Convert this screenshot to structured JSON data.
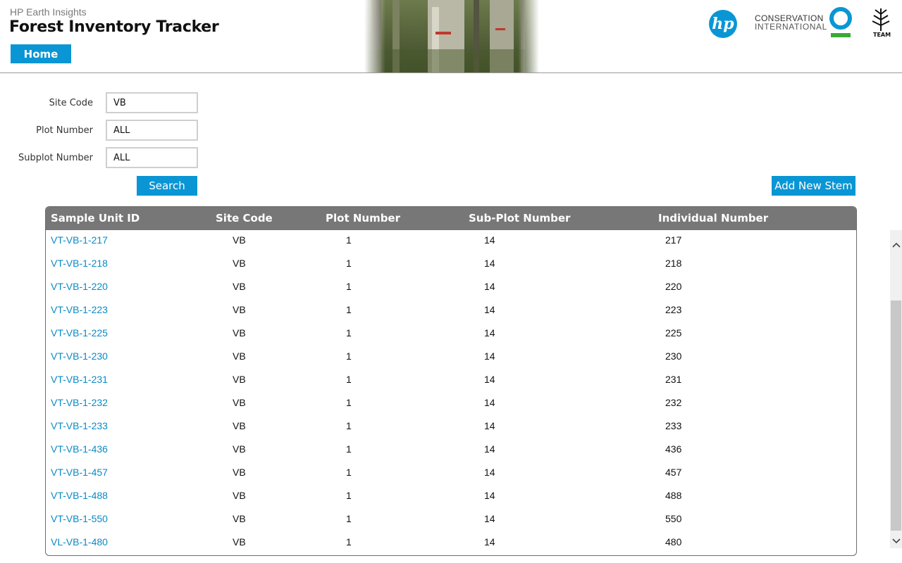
{
  "header": {
    "suite_name": "HP Earth Insights",
    "app_title": "Forest Inventory Tracker",
    "home_label": "Home",
    "hp_logo_text": "hp",
    "ci_line1": "CONSERVATION",
    "ci_line2": "INTERNATIONAL",
    "team_text": "TEAM"
  },
  "filters": {
    "site_code_label": "Site Code",
    "site_code_value": "VB",
    "plot_number_label": "Plot Number",
    "plot_number_value": "ALL",
    "subplot_number_label": "Subplot Number",
    "subplot_number_value": "ALL",
    "search_label": "Search",
    "add_label": "Add New Stem"
  },
  "table": {
    "columns": [
      "Sample Unit ID",
      "Site Code",
      "Plot Number",
      "Sub-Plot Number",
      "Individual Number"
    ],
    "rows": [
      [
        "VT-VB-1-217",
        "VB",
        "1",
        "14",
        "217"
      ],
      [
        "VT-VB-1-218",
        "VB",
        "1",
        "14",
        "218"
      ],
      [
        "VT-VB-1-220",
        "VB",
        "1",
        "14",
        "220"
      ],
      [
        "VT-VB-1-223",
        "VB",
        "1",
        "14",
        "223"
      ],
      [
        "VT-VB-1-225",
        "VB",
        "1",
        "14",
        "225"
      ],
      [
        "VT-VB-1-230",
        "VB",
        "1",
        "14",
        "230"
      ],
      [
        "VT-VB-1-231",
        "VB",
        "1",
        "14",
        "231"
      ],
      [
        "VT-VB-1-232",
        "VB",
        "1",
        "14",
        "232"
      ],
      [
        "VT-VB-1-233",
        "VB",
        "1",
        "14",
        "233"
      ],
      [
        "VT-VB-1-436",
        "VB",
        "1",
        "14",
        "436"
      ],
      [
        "VT-VB-1-457",
        "VB",
        "1",
        "14",
        "457"
      ],
      [
        "VT-VB-1-488",
        "VB",
        "1",
        "14",
        "488"
      ],
      [
        "VT-VB-1-550",
        "VB",
        "1",
        "14",
        "550"
      ],
      [
        "VL-VB-1-480",
        "VB",
        "1",
        "14",
        "480"
      ]
    ]
  },
  "colors": {
    "accent": "#0a96d4",
    "link": "#0a8ac6",
    "table_header": "#777777",
    "ci_blue": "#0a96d4",
    "ci_green": "#3aa935"
  },
  "icons": {
    "scroll_up": "chevron-up-icon",
    "scroll_down": "chevron-down-icon"
  }
}
